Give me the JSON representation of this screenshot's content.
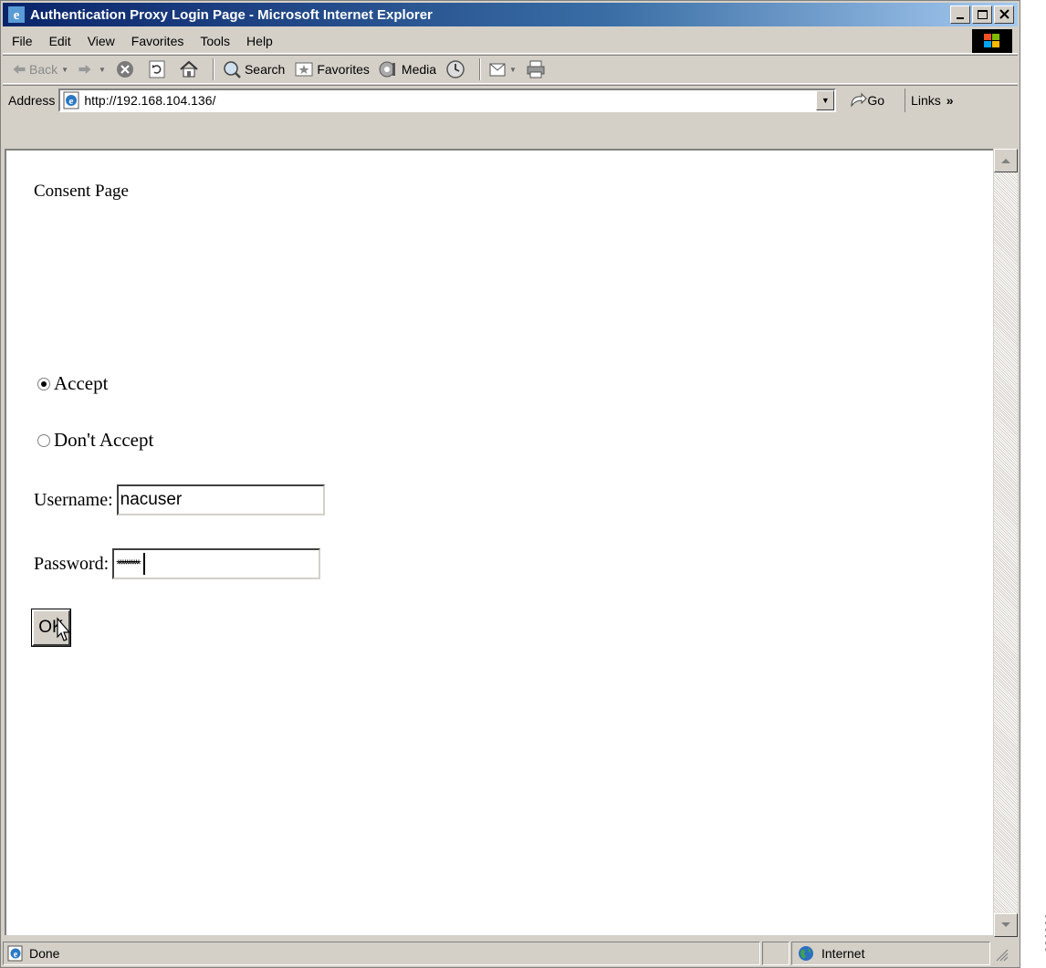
{
  "window": {
    "title": "Authentication Proxy Login Page - Microsoft Internet Explorer",
    "controls": [
      "minimize",
      "maximize",
      "close"
    ]
  },
  "menu": {
    "items": [
      "File",
      "Edit",
      "View",
      "Favorites",
      "Tools",
      "Help"
    ]
  },
  "toolbar": {
    "back_label": "Back",
    "search_label": "Search",
    "favorites_label": "Favorites",
    "media_label": "Media"
  },
  "address": {
    "label": "Address",
    "url": "http://192.168.104.136/",
    "go_label": "Go",
    "links_label": "Links"
  },
  "page": {
    "heading": "Consent Page",
    "accept_label": "Accept",
    "accept_checked": true,
    "dont_accept_label": "Don't Accept",
    "username_label": "Username:",
    "username_value": "nacuser",
    "password_label": "Password:",
    "password_value": "**********",
    "ok_label": "OK"
  },
  "status": {
    "text": "Done",
    "zone": "Internet"
  },
  "figure_id": "231216",
  "colors": {
    "titlebar": "#0a246a",
    "chrome": "#d4d0c8",
    "content_bg": "#ffffff"
  }
}
